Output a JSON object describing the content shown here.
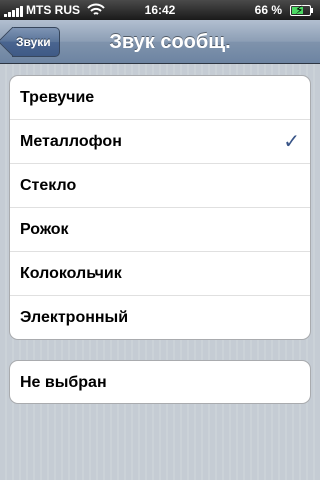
{
  "status_bar": {
    "carrier": "MTS RUS",
    "time": "16:42",
    "battery_percent": "66 %",
    "battery_level": 0.66,
    "icons": [
      "signal-icon",
      "wifi-icon",
      "battery-icon",
      "charging-bolt-icon"
    ]
  },
  "nav": {
    "back_label": "Звуки",
    "title": "Звук сообщ."
  },
  "sounds": {
    "items": [
      {
        "label": "Тревучие",
        "selected": false
      },
      {
        "label": "Металлофон",
        "selected": true
      },
      {
        "label": "Стекло",
        "selected": false
      },
      {
        "label": "Рожок",
        "selected": false
      },
      {
        "label": "Колокольчик",
        "selected": false
      },
      {
        "label": "Электронный",
        "selected": false
      }
    ],
    "none_label": "Не выбран",
    "check_glyph": "✓"
  },
  "colors": {
    "nav_bar": "#6d84a2",
    "checkmark": "#385487",
    "background": "#c5ccd4"
  }
}
